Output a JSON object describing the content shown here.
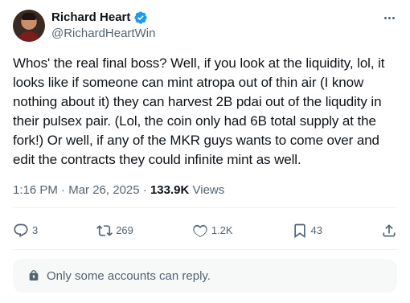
{
  "author": {
    "display_name": "Richard Heart",
    "handle": "@RichardHeartWin"
  },
  "tweet": {
    "text": "Whos' the real final boss? Well, if you look at the liquidity, lol, it looks like if someone can mint atropa out of thin air (I know nothing about it) they can harvest 2B pdai out of the liqudity in their pulsex pair. (Lol, the coin only had 6B total supply at the fork!) Or well, if any of the MKR guys wants to come over and edit the contracts they could infinite mint as well.",
    "time": "1:16 PM",
    "separator": " · ",
    "date": "Mar 26, 2025",
    "views_count": "133.9K",
    "views_label": "Views"
  },
  "actions": {
    "replies": "3",
    "reposts": "269",
    "likes": "1.2K",
    "bookmarks": "43"
  },
  "reply_restriction": "Only some accounts can reply.",
  "colors": {
    "verified": "#1d9bf0",
    "muted": "#536471",
    "text": "#0f1419"
  },
  "icons": [
    "verified-badge-icon",
    "more-options-icon",
    "reply-icon",
    "repost-icon",
    "like-icon",
    "bookmark-icon",
    "share-icon",
    "lock-icon"
  ]
}
